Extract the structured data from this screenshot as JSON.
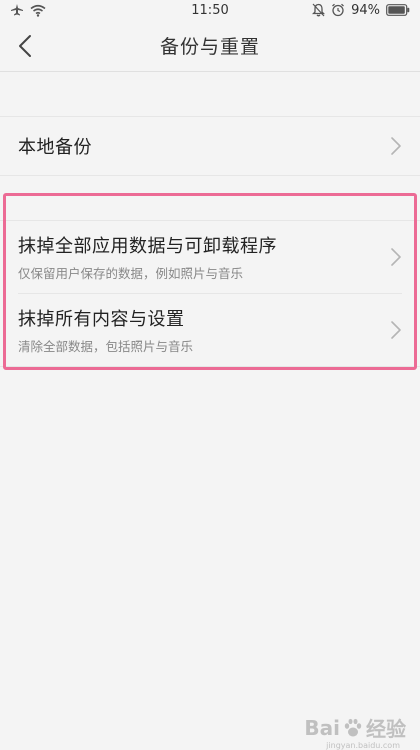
{
  "status_bar": {
    "time": "11:50",
    "battery_percent": "94%",
    "icons": [
      "airplane-icon",
      "wifi-icon",
      "notification-bell-icon",
      "alarm-icon",
      "battery-icon"
    ]
  },
  "header": {
    "title": "备份与重置",
    "back_icon": "chevron-left-icon"
  },
  "sections": {
    "local_backup": {
      "title": "本地备份"
    },
    "erase_apps": {
      "title": "抹掉全部应用数据与可卸载程序",
      "subtitle": "仅保留用户保存的数据，例如照片与音乐"
    },
    "erase_all": {
      "title": "抹掉所有内容与设置",
      "subtitle": "清除全部数据，包括照片与音乐"
    }
  },
  "watermark": {
    "text": "Bai",
    "text2": "经验",
    "sub": "jingyan.baidu.com"
  },
  "colors": {
    "background": "#f4f4f4",
    "highlight": "#ec6b95",
    "subtitle": "#888888",
    "chevron": "#b5b5b5"
  }
}
